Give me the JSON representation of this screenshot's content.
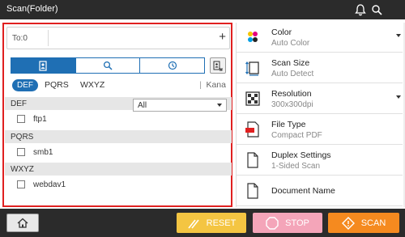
{
  "header": {
    "title": "Scan(Folder)",
    "icons": [
      "bell-icon",
      "search-icon"
    ]
  },
  "left": {
    "to_label": "To:0",
    "add_label": "+",
    "tabs": [
      "address-book-icon",
      "search-icon",
      "history-icon"
    ],
    "index": {
      "active": "DEF",
      "pqrs": "PQRS",
      "wxyz": "WXYZ",
      "separator": "|",
      "kana": "Kana"
    },
    "filter": {
      "selected": "All"
    },
    "groups": [
      {
        "header": "DEF",
        "items": [
          "ftp1"
        ]
      },
      {
        "header": "PQRS",
        "items": [
          "smb1"
        ]
      },
      {
        "header": "WXYZ",
        "items": [
          "webdav1"
        ]
      }
    ]
  },
  "right": {
    "options": [
      {
        "name": "Color",
        "value": "Auto Color",
        "icon": "color-icon"
      },
      {
        "name": "Scan Size",
        "value": "Auto Detect",
        "icon": "scan-size-icon"
      },
      {
        "name": "Resolution",
        "value": "300x300dpi",
        "icon": "resolution-icon"
      },
      {
        "name": "File Type",
        "value": "Compact PDF",
        "icon": "pdf-file-icon"
      },
      {
        "name": "Duplex Settings",
        "value": "1-Sided Scan",
        "icon": "duplex-icon"
      },
      {
        "name": "Document Name",
        "value": "",
        "icon": "document-icon"
      }
    ]
  },
  "bottom": {
    "reset": "RESET",
    "stop": "STOP",
    "scan": "SCAN"
  },
  "colors": {
    "header_bg": "#2b2b2b",
    "accent_blue": "#1f6fb4",
    "highlight_red": "#e02020",
    "reset": "#f4c542",
    "stop": "#f4a5b9",
    "scan": "#f58a1f"
  }
}
